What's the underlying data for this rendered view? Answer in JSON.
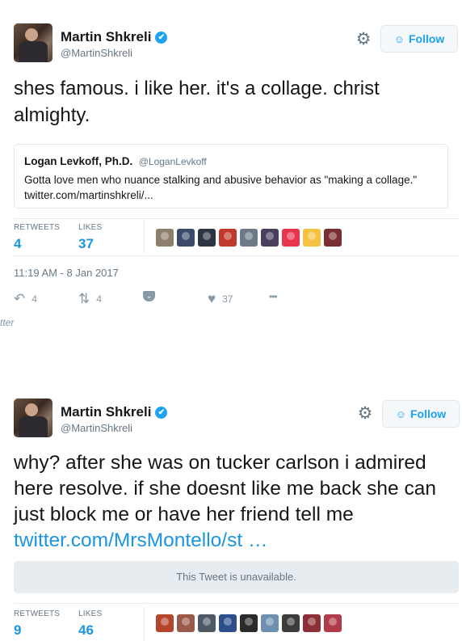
{
  "tweet1": {
    "author": {
      "name": "Martin Shkreli",
      "handle": "@MartinShkreli"
    },
    "follow_label": "Follow",
    "text": "shes famous. i like her. it's a collage. christ almighty.",
    "quote": {
      "name": "Logan Levkoff, Ph.D.",
      "handle": "@LoganLevkoff",
      "text": "Gotta love men who nuance stalking and abusive behavior as \"making a collage.\" twitter.com/martinshkreli/..."
    },
    "stats": {
      "retweets_label": "RETWEETS",
      "retweets": "4",
      "likes_label": "LIKES",
      "likes": "37"
    },
    "likers": [
      "#8d7f6b",
      "#3b4a6b",
      "#2b3440",
      "#c0392b",
      "#6c7a89",
      "#4b3f5e",
      "#e8344e",
      "#f5c242",
      "#7a2e2e"
    ],
    "timestamp": "11:19 AM - 8 Jan 2017",
    "actions": {
      "reply_count": "4",
      "retweet_count": "4",
      "like_count": "37"
    },
    "embed_cut_text": "tter"
  },
  "tweet2": {
    "author": {
      "name": "Martin Shkreli",
      "handle": "@MartinShkreli"
    },
    "follow_label": "Follow",
    "text": "why? after she was on tucker carlson i admired here resolve. if she doesnt like me back she can just block me or have her friend tell me",
    "link": "twitter.com/MrsMontello/st …",
    "unavailable": "This Tweet is unavailable.",
    "stats": {
      "retweets_label": "RETWEETS",
      "retweets": "9",
      "likes_label": "LIKES",
      "likes": "46"
    },
    "likers": [
      "#b5452c",
      "#9a5a4a",
      "#4d5a66",
      "#2c4f8c",
      "#2a2a2a",
      "#6d8fb0",
      "#3c3c3c",
      "#8c2f39",
      "#b03a48"
    ]
  },
  "icons": {
    "verified": "✔",
    "gear": "⚙",
    "follow": "☺",
    "reply": "↶",
    "retweet": "⇅",
    "like": "♥",
    "more": "•••",
    "pocket": "⌄"
  },
  "colors": {
    "accent": "#1da1f2",
    "link": "#1b95e0",
    "muted": "#657786"
  }
}
